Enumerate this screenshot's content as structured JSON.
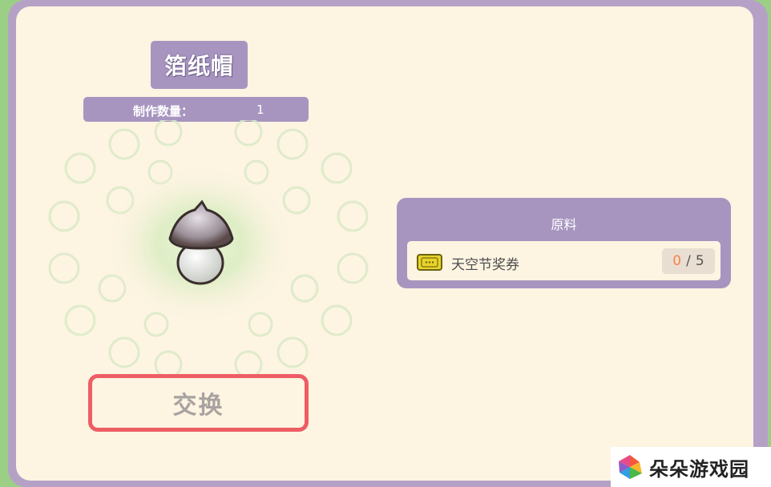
{
  "item": {
    "name": "箔纸帽",
    "quantity_label": "制作数量：",
    "quantity": "1"
  },
  "exchange": {
    "label": "交换"
  },
  "materials": {
    "title": "原料",
    "items": [
      {
        "name": "天空节奖券",
        "have": "0",
        "separator": "/",
        "need": "5",
        "icon": "ticket-icon"
      }
    ]
  },
  "watermark": {
    "text": "朵朵游戏园"
  },
  "colors": {
    "accent_purple": "#a795c0",
    "panel_bg": "#fdf4e2",
    "button_border": "#ef5d64",
    "count_shortfall": "#ff7e4d"
  }
}
